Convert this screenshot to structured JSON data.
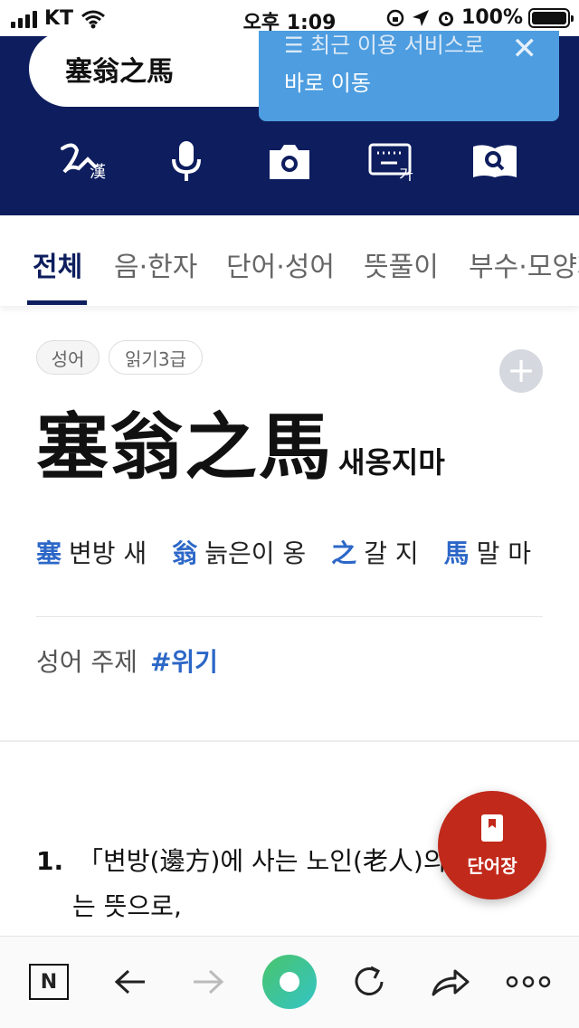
{
  "status_bar": {
    "carrier": "KT",
    "time": "오후 1:09",
    "battery": "100%"
  },
  "header": {
    "search_value": "塞翁之馬",
    "toast": {
      "line1": "☰ 최근 이용 서비스로",
      "line2": "바로 이동",
      "close": "✕"
    },
    "tools": [
      {
        "icon": "handwriting-hanja-icon",
        "sub": "漢"
      },
      {
        "icon": "microphone-icon"
      },
      {
        "icon": "camera-icon"
      },
      {
        "icon": "keyboard-icon",
        "sub": "가"
      },
      {
        "icon": "book-search-icon"
      }
    ]
  },
  "tabs": [
    {
      "label": "전체",
      "active": true
    },
    {
      "label": "음·한자"
    },
    {
      "label": "단어·성어"
    },
    {
      "label": "뜻풀이"
    },
    {
      "label": "부수·모양자"
    }
  ],
  "entry": {
    "chips": [
      "성어",
      "읽기3급"
    ],
    "title": "塞翁之馬",
    "reading": "새옹지마",
    "chars": [
      {
        "hanja": "塞",
        "meaning": "변방 새"
      },
      {
        "hanja": "翁",
        "meaning": "늙은이 옹"
      },
      {
        "hanja": "之",
        "meaning": "갈 지"
      },
      {
        "hanja": "馬",
        "meaning": "말 마"
      }
    ],
    "theme_label": "성어 주제",
    "theme_tag": "#위기"
  },
  "meaning": {
    "number": "1.",
    "line1": "「변방(邊方)에 사는 노인(老人)의",
    "line2": "는 뜻으로,"
  },
  "fab": {
    "label": "단어장"
  },
  "colors": {
    "navy": "#0d1d5e",
    "toast": "#4d9de0",
    "link": "#2c67c7",
    "fab": "#c1291b"
  }
}
